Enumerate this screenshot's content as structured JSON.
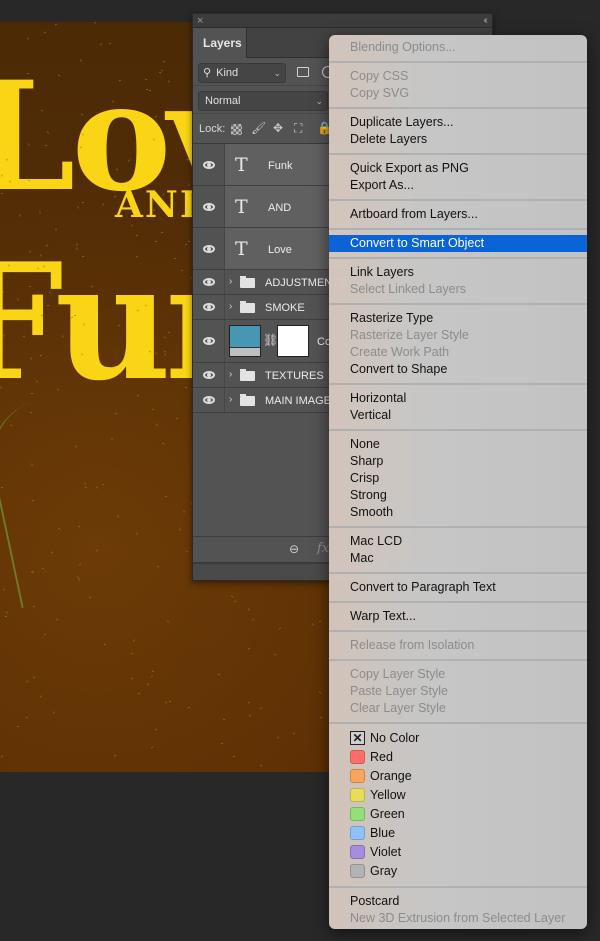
{
  "canvas": {
    "artwork_words": [
      "Love",
      "AND",
      "Funk"
    ],
    "background_color": "#5a3005",
    "text_color": "#f9d516"
  },
  "layers_panel": {
    "close_icon": "×",
    "collapse_icon": "‹‹",
    "tab_label": "Layers",
    "filter": {
      "search_glyph": "⚲",
      "kind_value": "Kind",
      "chevron": "⌄"
    },
    "blend_mode": "Normal",
    "lock_label": "Lock:",
    "lock_icons": {
      "brush": "🖌",
      "move": "✥",
      "artboard": "⛶",
      "all": "🔒"
    },
    "layers": [
      {
        "type": "text",
        "name": "Funk",
        "visible": true
      },
      {
        "type": "text",
        "name": "AND",
        "visible": true
      },
      {
        "type": "text",
        "name": "Love",
        "visible": true
      },
      {
        "type": "group",
        "name": "ADJUSTMENTS",
        "visible": true
      },
      {
        "type": "group",
        "name": "SMOKE",
        "visible": true
      },
      {
        "type": "adjustment",
        "name": "Co",
        "visible": true,
        "thumb_color": "#4797b3"
      },
      {
        "type": "group",
        "name": "TEXTURES",
        "visible": true
      },
      {
        "type": "group",
        "name": "MAIN IMAGE",
        "visible": true
      }
    ],
    "text_layer_glyph": "T",
    "group_chevron": "›",
    "link_glyph": "⛓",
    "footer": {
      "link_glyph": "⊖",
      "fx_label": "fx"
    }
  },
  "context_menu": {
    "selected_color": "#0a64d6",
    "sections": [
      [
        {
          "label": "Blending Options...",
          "disabled": true
        }
      ],
      [
        {
          "label": "Copy CSS",
          "disabled": true
        },
        {
          "label": "Copy SVG",
          "disabled": true
        }
      ],
      [
        {
          "label": "Duplicate Layers...",
          "disabled": false
        },
        {
          "label": "Delete Layers",
          "disabled": false
        }
      ],
      [
        {
          "label": "Quick Export as PNG",
          "disabled": false
        },
        {
          "label": "Export As...",
          "disabled": false
        }
      ],
      [
        {
          "label": "Artboard from Layers...",
          "disabled": false
        }
      ],
      [
        {
          "label": "Convert to Smart Object",
          "disabled": false,
          "selected": true
        }
      ],
      [
        {
          "label": "Link Layers",
          "disabled": false
        },
        {
          "label": "Select Linked Layers",
          "disabled": true
        }
      ],
      [
        {
          "label": "Rasterize Type",
          "disabled": false
        },
        {
          "label": "Rasterize Layer Style",
          "disabled": true
        },
        {
          "label": "Create Work Path",
          "disabled": true
        },
        {
          "label": "Convert to Shape",
          "disabled": false
        }
      ],
      [
        {
          "label": "Horizontal",
          "disabled": false
        },
        {
          "label": "Vertical",
          "disabled": false
        }
      ],
      [
        {
          "label": "None",
          "disabled": false
        },
        {
          "label": "Sharp",
          "disabled": false
        },
        {
          "label": "Crisp",
          "disabled": false
        },
        {
          "label": "Strong",
          "disabled": false
        },
        {
          "label": "Smooth",
          "disabled": false
        }
      ],
      [
        {
          "label": "Mac LCD",
          "disabled": false
        },
        {
          "label": "Mac",
          "disabled": false
        }
      ],
      [
        {
          "label": "Convert to Paragraph Text",
          "disabled": false
        }
      ],
      [
        {
          "label": "Warp Text...",
          "disabled": false
        }
      ],
      [
        {
          "label": "Release from Isolation",
          "disabled": true
        }
      ],
      [
        {
          "label": "Copy Layer Style",
          "disabled": true
        },
        {
          "label": "Paste Layer Style",
          "disabled": true
        },
        {
          "label": "Clear Layer Style",
          "disabled": true
        }
      ]
    ],
    "colors": [
      {
        "label": "No Color",
        "swatch": "none",
        "glyph": "✕"
      },
      {
        "label": "Red",
        "swatch": "#fb6f6b"
      },
      {
        "label": "Orange",
        "swatch": "#fba45c"
      },
      {
        "label": "Yellow",
        "swatch": "#e6dd5c"
      },
      {
        "label": "Green",
        "swatch": "#93df7a"
      },
      {
        "label": "Blue",
        "swatch": "#8fc2fb"
      },
      {
        "label": "Violet",
        "swatch": "#a58ee0"
      },
      {
        "label": "Gray",
        "swatch": "#b3b3b3"
      }
    ],
    "final_section": [
      {
        "label": "Postcard",
        "disabled": false
      },
      {
        "label": "New 3D Extrusion from Selected Layer",
        "disabled": true
      }
    ]
  }
}
